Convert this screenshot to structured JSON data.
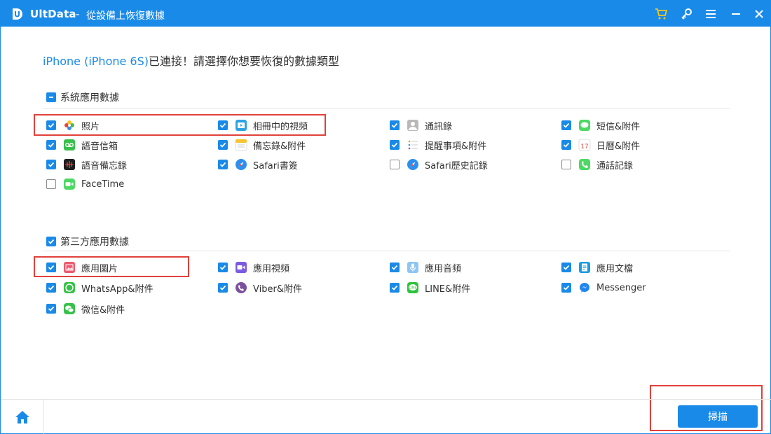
{
  "window": {
    "app_name": "UltData",
    "separator": "-",
    "title": "從設備上恢復數據",
    "accent_color": "#1a8ae8",
    "controls": [
      "cart-icon",
      "key-icon",
      "menu-icon",
      "minimize-icon",
      "close-icon"
    ]
  },
  "heading": {
    "device": "iPhone (iPhone 6S)",
    "text": "已連接！請選擇你想要恢復的數據類型"
  },
  "system_section": {
    "label": "系統應用數據",
    "state": "partial",
    "items": [
      {
        "label": "照片",
        "checked": true,
        "icon": "photos-icon"
      },
      {
        "label": "相冊中的視頻",
        "checked": true,
        "icon": "album-video-icon"
      },
      {
        "label": "通訊錄",
        "checked": true,
        "icon": "contacts-icon"
      },
      {
        "label": "短信&附件",
        "checked": true,
        "icon": "messages-icon"
      },
      {
        "label": "語音信箱",
        "checked": true,
        "icon": "voicemail-icon"
      },
      {
        "label": "備忘錄&附件",
        "checked": true,
        "icon": "notes-icon"
      },
      {
        "label": "提醒事項&附件",
        "checked": true,
        "icon": "reminders-icon"
      },
      {
        "label": "日曆&附件",
        "checked": true,
        "icon": "calendar-icon"
      },
      {
        "label": "語音備忘錄",
        "checked": true,
        "icon": "voice-memos-icon"
      },
      {
        "label": "Safari書簽",
        "checked": true,
        "icon": "safari-icon"
      },
      {
        "label": "Safari歷史記錄",
        "checked": false,
        "icon": "safari-icon"
      },
      {
        "label": "通話記錄",
        "checked": false,
        "icon": "phone-icon"
      },
      {
        "label": "FaceTime",
        "checked": false,
        "icon": "facetime-icon"
      }
    ]
  },
  "third_party_section": {
    "label": "第三方應用數據",
    "state": "checked",
    "items": [
      {
        "label": "應用圖片",
        "checked": true,
        "icon": "app-photo-icon"
      },
      {
        "label": "應用視頻",
        "checked": true,
        "icon": "app-video-icon"
      },
      {
        "label": "應用音頻",
        "checked": true,
        "icon": "app-audio-icon"
      },
      {
        "label": "應用文檔",
        "checked": true,
        "icon": "app-document-icon"
      },
      {
        "label": "WhatsApp&附件",
        "checked": true,
        "icon": "whatsapp-icon"
      },
      {
        "label": "Viber&附件",
        "checked": true,
        "icon": "viber-icon"
      },
      {
        "label": "LINE&附件",
        "checked": true,
        "icon": "line-icon"
      },
      {
        "label": "Messenger",
        "checked": true,
        "icon": "messenger-icon"
      },
      {
        "label": "微信&附件",
        "checked": true,
        "icon": "wechat-icon"
      }
    ]
  },
  "highlight_color": "#e0413a",
  "footer": {
    "home_icon": "home-icon",
    "scan_label": "掃描"
  }
}
